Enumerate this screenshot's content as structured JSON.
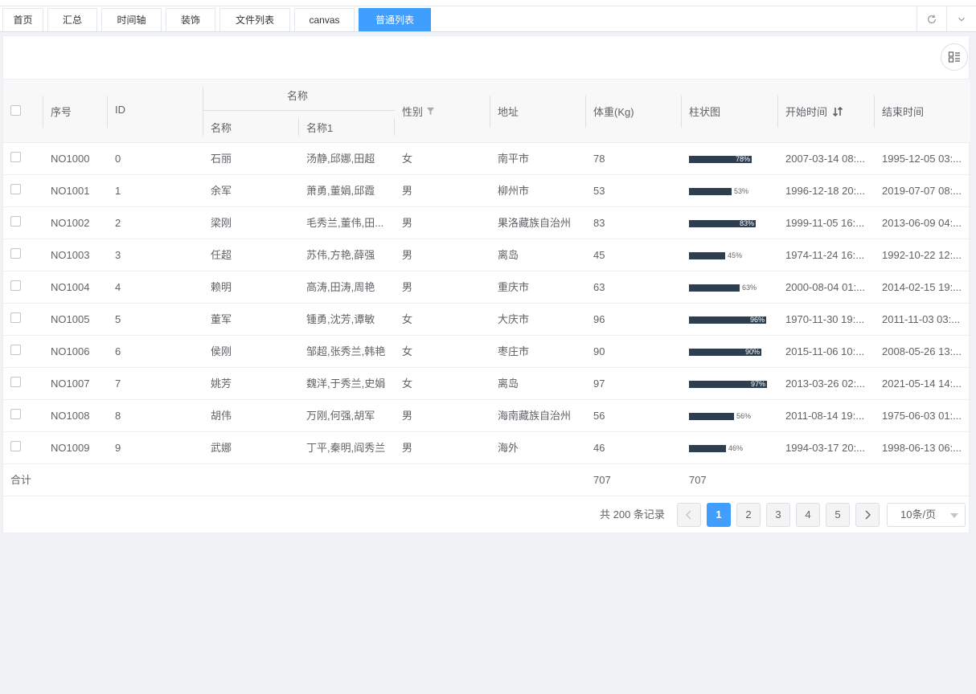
{
  "tabs": [
    {
      "label": "首页"
    },
    {
      "label": "汇总"
    },
    {
      "label": "时间轴"
    },
    {
      "label": "装饰"
    },
    {
      "label": "文件列表"
    },
    {
      "label": "canvas"
    },
    {
      "label": "普通列表",
      "active": true
    }
  ],
  "icons": {
    "refresh": "refresh-icon",
    "more": "chevron-down-icon",
    "columns": "column-settings-icon",
    "filter": "filter-icon",
    "sort": "sort-icon"
  },
  "accent": "#409eff",
  "bar_color": "#2e3e4e",
  "table": {
    "headers": {
      "seq": "序号",
      "id": "ID",
      "name_group": "名称",
      "name": "名称",
      "name1": "名称1",
      "gender": "性别",
      "address": "地址",
      "weight": "体重(Kg)",
      "bar": "柱状图",
      "start": "开始时间",
      "end": "结束时间"
    },
    "rows": [
      {
        "seq": "NO1000",
        "id": "0",
        "name": "石丽",
        "name1": "汤静,邱娜,田超",
        "gender": "女",
        "address": "南平市",
        "weight": "78",
        "pct": 78,
        "pct_label": "78%",
        "start": "2007-03-14 08:...",
        "end": "1995-12-05 03:..."
      },
      {
        "seq": "NO1001",
        "id": "1",
        "name": "余军",
        "name1": "萧勇,董娟,邱霞",
        "gender": "男",
        "address": "柳州市",
        "weight": "53",
        "pct": 53,
        "pct_label": "53%",
        "start": "1996-12-18 20:...",
        "end": "2019-07-07 08:..."
      },
      {
        "seq": "NO1002",
        "id": "2",
        "name": "梁刚",
        "name1": "毛秀兰,董伟,田...",
        "gender": "男",
        "address": "果洛藏族自治州",
        "weight": "83",
        "pct": 83,
        "pct_label": "83%",
        "start": "1999-11-05 16:...",
        "end": "2013-06-09 04:..."
      },
      {
        "seq": "NO1003",
        "id": "3",
        "name": "任超",
        "name1": "苏伟,方艳,薛强",
        "gender": "男",
        "address": "离岛",
        "weight": "45",
        "pct": 45,
        "pct_label": "45%",
        "start": "1974-11-24 16:...",
        "end": "1992-10-22 12:..."
      },
      {
        "seq": "NO1004",
        "id": "4",
        "name": "赖明",
        "name1": "高涛,田涛,周艳",
        "gender": "男",
        "address": "重庆市",
        "weight": "63",
        "pct": 63,
        "pct_label": "63%",
        "start": "2000-08-04 01:...",
        "end": "2014-02-15 19:..."
      },
      {
        "seq": "NO1005",
        "id": "5",
        "name": "董军",
        "name1": "锺勇,沈芳,谭敏",
        "gender": "女",
        "address": "大庆市",
        "weight": "96",
        "pct": 96,
        "pct_label": "96%",
        "start": "1970-11-30 19:...",
        "end": "2011-11-03 03:..."
      },
      {
        "seq": "NO1006",
        "id": "6",
        "name": "侯刚",
        "name1": "邹超,张秀兰,韩艳",
        "gender": "女",
        "address": "枣庄市",
        "weight": "90",
        "pct": 90,
        "pct_label": "90%",
        "start": "2015-11-06 10:...",
        "end": "2008-05-26 13:..."
      },
      {
        "seq": "NO1007",
        "id": "7",
        "name": "姚芳",
        "name1": "魏洋,于秀兰,史娟",
        "gender": "女",
        "address": "离岛",
        "weight": "97",
        "pct": 97,
        "pct_label": "97%",
        "start": "2013-03-26 02:...",
        "end": "2021-05-14 14:..."
      },
      {
        "seq": "NO1008",
        "id": "8",
        "name": "胡伟",
        "name1": "万刚,何强,胡军",
        "gender": "男",
        "address": "海南藏族自治州",
        "weight": "56",
        "pct": 56,
        "pct_label": "56%",
        "start": "2011-08-14 19:...",
        "end": "1975-06-03 01:..."
      },
      {
        "seq": "NO1009",
        "id": "9",
        "name": "武娜",
        "name1": "丁平,秦明,阎秀兰",
        "gender": "男",
        "address": "海外",
        "weight": "46",
        "pct": 46,
        "pct_label": "46%",
        "start": "1994-03-17 20:...",
        "end": "1998-06-13 06:..."
      }
    ],
    "footer": {
      "label": "合计",
      "weight_total": "707",
      "bar_total": "707"
    }
  },
  "pagination": {
    "total_text": "共 200 条记录",
    "pages": [
      "1",
      "2",
      "3",
      "4",
      "5"
    ],
    "current": "1",
    "page_size": "10条/页"
  }
}
